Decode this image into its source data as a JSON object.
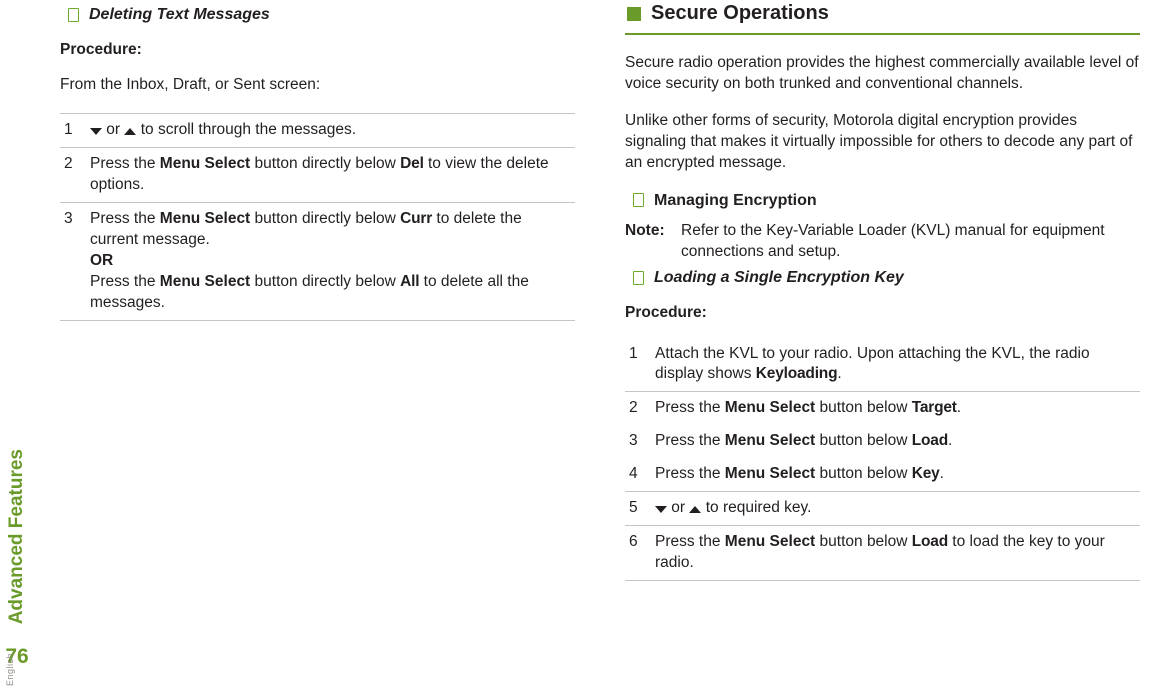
{
  "meta": {
    "section": "Advanced Features",
    "page": "76",
    "lang": "English"
  },
  "left": {
    "heading": "Deleting Text Messages",
    "procedure_label": "Procedure:",
    "intro": "From the Inbox, Draft, or Sent screen:",
    "steps": {
      "s1": {
        "num": "1",
        "pre_arrows": "",
        "between": " or ",
        "after": " to scroll through the messages."
      },
      "s2": {
        "num": "2",
        "a": "Press the ",
        "b": "Menu Select",
        "c": " button directly below ",
        "d": "Del",
        "e": " to view the delete options."
      },
      "s3": {
        "num": "3",
        "a": "Press the ",
        "b": "Menu Select",
        "c": " button directly below ",
        "d": "Curr",
        "e": " to delete the current message.",
        "or": "OR",
        "f": "Press the ",
        "g": "Menu Select",
        "h": " button directly below ",
        "i": "All",
        "j": " to delete all the messages."
      }
    }
  },
  "right": {
    "major": "Secure Operations",
    "p1": "Secure radio operation provides the highest commercially available level of voice security on both trunked and conventional channels.",
    "p2": "Unlike other forms of security, Motorola digital encryption provides signaling that makes it virtually impossible for others to decode any part of an encrypted message.",
    "sub1": "Managing Encryption",
    "note_label": "Note:",
    "note_body": "Refer to the Key-Variable Loader (KVL) manual for equipment connections and setup.",
    "sub2": "Loading a Single Encryption Key",
    "procedure_label": "Procedure:",
    "steps": {
      "s1": {
        "num": "1",
        "a": "Attach the KVL to your radio. Upon attaching the KVL, the radio display shows ",
        "b": "Keyloading",
        "c": "."
      },
      "s2": {
        "num": "2",
        "a": "Press the ",
        "b": "Menu Select",
        "c": " button below ",
        "d": "Target",
        "e": "."
      },
      "s3": {
        "num": "3",
        "a": "Press the ",
        "b": "Menu Select",
        "c": " button below ",
        "d": "Load",
        "e": "."
      },
      "s4": {
        "num": "4",
        "a": "Press the ",
        "b": "Menu Select",
        "c": " button below ",
        "d": "Key",
        "e": "."
      },
      "s5": {
        "num": "5",
        "between": " or ",
        "after": " to required key."
      },
      "s6": {
        "num": "6",
        "a": "Press the ",
        "b": "Menu Select",
        "c": " button below ",
        "d": "Load",
        "e": " to load the key to your radio."
      }
    }
  }
}
